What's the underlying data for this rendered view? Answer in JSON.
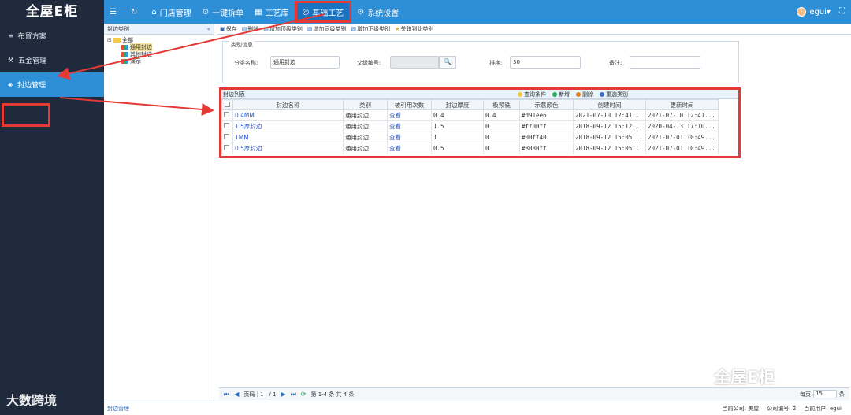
{
  "app": {
    "logo": "全屋E柜"
  },
  "nav": [
    {
      "icon": "☰",
      "label": ""
    },
    {
      "icon": "↻",
      "label": ""
    },
    {
      "icon": "⌂",
      "label": "门店管理"
    },
    {
      "icon": "⊙",
      "label": "一键拆单"
    },
    {
      "icon": "▦",
      "label": "工艺库"
    },
    {
      "icon": "◎",
      "label": "基础工艺"
    },
    {
      "icon": "⚙",
      "label": "系统设置"
    }
  ],
  "user": {
    "name": "egui",
    "caret": "▾"
  },
  "sidebar": [
    {
      "icon": "≡",
      "label": "布置方案"
    },
    {
      "icon": "⚒",
      "label": "五金管理"
    },
    {
      "icon": "◈",
      "label": "封边管理"
    }
  ],
  "tree_panel": {
    "title": "封边类别",
    "collapse": "«",
    "root": "全部",
    "children": [
      "通用封边",
      "其他封边",
      "演示"
    ]
  },
  "toolbar": [
    {
      "icon": "▣",
      "label": "保存"
    },
    {
      "icon": "▤",
      "label": "删除"
    },
    {
      "icon": "▨",
      "label": "增加顶级类别"
    },
    {
      "icon": "▨",
      "label": "增加同级类别"
    },
    {
      "icon": "▨",
      "label": "增加下级类别"
    },
    {
      "icon": "★",
      "label": "关联到此类别"
    }
  ],
  "form": {
    "legend": "类别信息",
    "name_label": "分类名称:",
    "name_value": "通用封边",
    "parent_label": "父级编号:",
    "parent_value": "",
    "search_icon": "🔍",
    "order_label": "排序:",
    "order_value": "30",
    "note_label": "备注:",
    "note_value": ""
  },
  "grid": {
    "title": "封边列表",
    "actions": [
      {
        "label": "查询条件",
        "color": "#f2c94c"
      },
      {
        "label": "新增",
        "color": "#27ae60"
      },
      {
        "label": "删除",
        "color": "#e67e22"
      },
      {
        "label": "重选类别",
        "color": "#3b6fd8"
      }
    ],
    "columns": [
      "封边名称",
      "类别",
      "被引用次数",
      "封边厚度",
      "板预铣",
      "示意颜色",
      "创建时间",
      "更新时间"
    ],
    "rows": [
      [
        "0.4MM",
        "通用封边",
        "查看",
        "0.4",
        "0.4",
        "#d91ee6",
        "2021-07-10 12:41...",
        "2021-07-10 12:41..."
      ],
      [
        "1.5厚封边",
        "通用封边",
        "查看",
        "1.5",
        "0",
        "#ff00ff",
        "2018-09-12 15:12...",
        "2020-04-13 17:10..."
      ],
      [
        "1MM",
        "通用封边",
        "查看",
        "1",
        "0",
        "#00ff40",
        "2018-09-12 15:05...",
        "2021-07-01 10:49..."
      ],
      [
        "0.5厚封边",
        "通用封边",
        "查看",
        "0.5",
        "0",
        "#8080ff",
        "2018-09-12 15:05...",
        "2021-07-01 10:49..."
      ]
    ]
  },
  "pager": {
    "first": "⏮",
    "prev": "◀",
    "page_label": "页码",
    "page": "1",
    "of": "/ 1",
    "next": "▶",
    "last": "⏭",
    "refresh": "⟳",
    "summary": "第 1-4 条  共 4 条",
    "per_page_label": "每页",
    "per_page": "15",
    "unit": "条"
  },
  "footer": {
    "breadcrumb": "封边管理",
    "company": "当前公司: 美屋",
    "company_no": "公司编号: 2",
    "current_user": "当前用户: egui"
  },
  "watermarks": {
    "left": "大数跨境",
    "right": "全屋E柜"
  }
}
